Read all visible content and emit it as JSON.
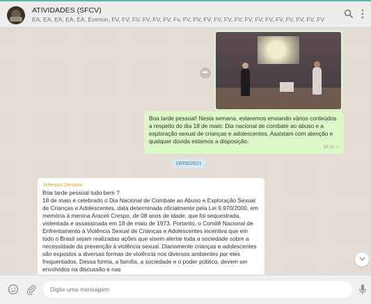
{
  "header": {
    "title": "ATIVIDADES (SFCV)",
    "members": "EA, EA, EA, EA, EA, Everton, FV, FV, FV, FV, FV, FV, Fv, FV, FV, FV, FV, FV, FV, FV, FV, FV, FV, FV, FV, FV, FV, FV, FV, FV, FV, FV, FV, FV, FV, FV, FV, FV, FV, FV, FV, FV, FV, ...",
    "search_icon": "search-icon",
    "menu_icon": "more-vertical-icon"
  },
  "messages": {
    "outgoing_text": "Boa tarde pessoal! Nesta semana, estaremos enviando vários conteúdos a respeito do dia 18 de maio: Dia nacional de combate ao abuso e a exploração sexual de crianças e adolescentes. Assistam com atenção e qualquer dúvida estamos a disposição.",
    "outgoing_time": "16:21 ✓",
    "date_separator": "18/05/2021",
    "incoming_sender": "Jeferson Serrano",
    "incoming_greeting": "Boa tarde pessoal tudo bem ?",
    "incoming_text": "18 de maio é celebrado o Dia Nacional de Combate ao Abuso e Exploração Sexual de Crianças e Adolescentes, data determinada oficialmente pela Lei 9.970/2000, em memória à menina Araceli Crespo, de 08 anos de idade, que foi sequestrada, violentada e assassinada em 18 de maio de 1973. Portanto, o Comitê Nacional de Enfrentamento à Violência Sexual de Crianças e Adolescentes incentiva que em todo o Brasil sejam realizadas ações que visem alertar toda a sociedade sobre a necessidade da prevenção à violência sexual. Diariamente crianças e adolescentes são expostos a diversas formas de violência nos diversos ambientes por eles frequentados. Dessa forma, a família, a sociedade e o poder público, devem ser envolvidos na discussão e nas"
  },
  "footer": {
    "placeholder": "Digite uma mensagem",
    "emoji_icon": "emoji-icon",
    "attach_icon": "attach-icon",
    "mic_icon": "mic-icon"
  },
  "colors": {
    "outgoing_bubble": "#dcf8c6",
    "incoming_bubble": "#ffffff",
    "chat_background": "#e5ddd5",
    "sender_name": "#d49f1c",
    "accent": "#56b9a8"
  }
}
